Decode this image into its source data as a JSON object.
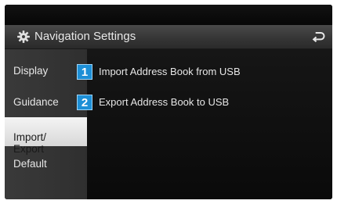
{
  "header": {
    "title": "Navigation Settings",
    "icon": "gear-icon",
    "back_icon": "back-arrow-icon"
  },
  "sidebar": {
    "items": [
      {
        "label": "Display",
        "active": false
      },
      {
        "label": "Guidance",
        "active": false
      },
      {
        "label": "Import/\nExport",
        "active": true
      },
      {
        "label": "Default",
        "active": false
      }
    ]
  },
  "menu": {
    "items": [
      {
        "number": "1",
        "label": "Import Address Book from USB"
      },
      {
        "number": "2",
        "label": "Export Address Book to USB"
      }
    ]
  },
  "colors": {
    "badge": "#1d8fd6",
    "active_tab": "#e6e6e6",
    "background": "#050505"
  }
}
